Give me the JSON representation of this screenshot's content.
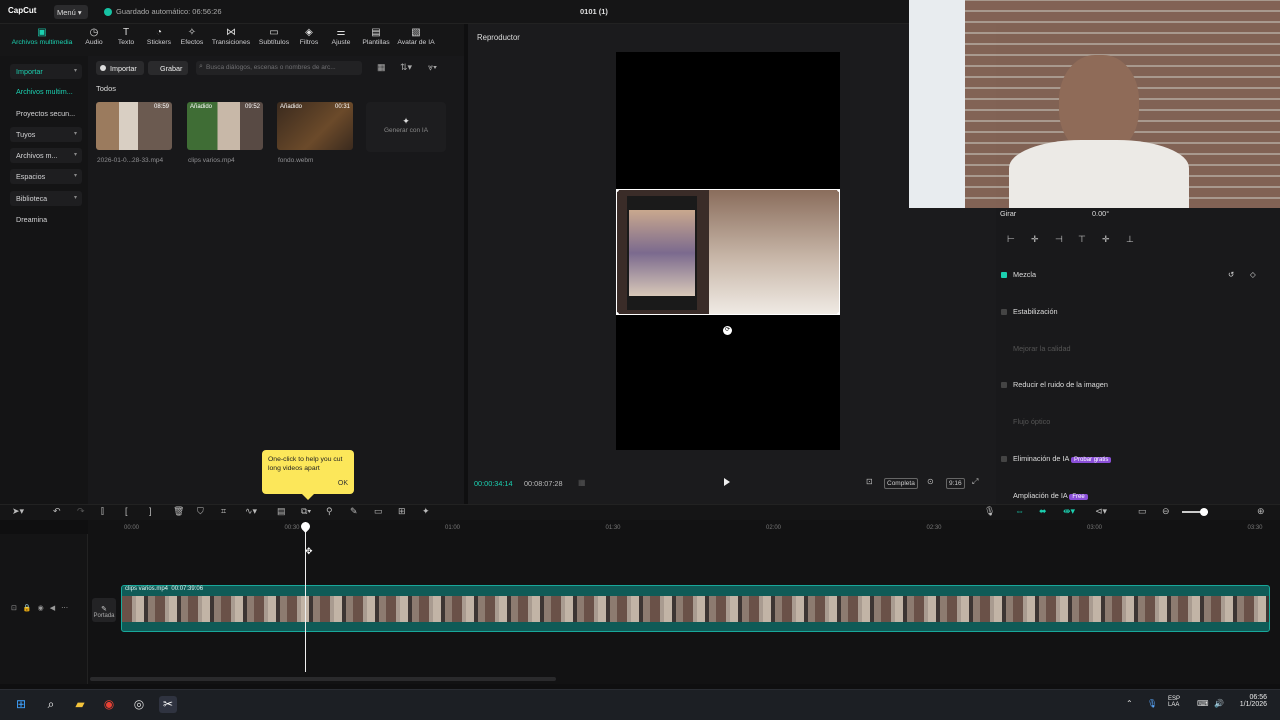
{
  "app": {
    "logo": "CapCut",
    "menu": "Menú",
    "autosave": "Guardado automático: 06:56:26",
    "project_title": "0101 (1)"
  },
  "toolbar": [
    {
      "label": "Archivos multimedia",
      "icon": "media-icon",
      "glyph": "▣",
      "active": true
    },
    {
      "label": "Audio",
      "icon": "audio-icon",
      "glyph": "◷"
    },
    {
      "label": "Texto",
      "icon": "text-icon",
      "glyph": "T"
    },
    {
      "label": "Stickers",
      "icon": "sticker-icon",
      "glyph": "◔"
    },
    {
      "label": "Efectos",
      "icon": "effects-icon",
      "glyph": "✧"
    },
    {
      "label": "Transiciones",
      "icon": "transitions-icon",
      "glyph": "⋈"
    },
    {
      "label": "Subtítulos",
      "icon": "subtitles-icon",
      "glyph": "▭"
    },
    {
      "label": "Filtros",
      "icon": "filters-icon",
      "glyph": "◈"
    },
    {
      "label": "Ajuste",
      "icon": "adjust-icon",
      "glyph": "⚌"
    },
    {
      "label": "Plantillas",
      "icon": "templates-icon",
      "glyph": "▤"
    },
    {
      "label": "Avatar de IA",
      "icon": "ai-avatar-icon",
      "glyph": "▧"
    }
  ],
  "leftnav": [
    {
      "label": "Importar",
      "selected": true,
      "chev": true
    },
    {
      "label": "Archivos multim...",
      "selected": true,
      "plain": true
    },
    {
      "label": "Proyectos secun...",
      "plain": true
    },
    {
      "label": "Tuyos",
      "chev": true
    },
    {
      "label": "Archivos m...",
      "chev": true
    },
    {
      "label": "Espacios",
      "chev": true
    },
    {
      "label": "Biblioteca",
      "chev": true
    },
    {
      "label": "Dreamina",
      "plain": true
    }
  ],
  "media": {
    "import_label": "Importar",
    "record_label": "Grabar",
    "search_placeholder": "Busca diálogos, escenas o nombres de arc...",
    "section": "Todos",
    "items": [
      {
        "name": "2026-01-0...28-33.mp4",
        "badge": "",
        "duration": "08:59"
      },
      {
        "name": "clips varios.mp4",
        "badge": "Añadido",
        "duration": "09:52"
      },
      {
        "name": "fondo.webm",
        "badge": "Añadido",
        "duration": "00:31"
      }
    ],
    "ai_generate": "Generar con IA"
  },
  "tooltip": {
    "text": "One-click to help you cut long videos apart",
    "ok": "OK"
  },
  "player": {
    "title": "Reproductor",
    "current_time": "00:00:34:14",
    "total_time": "00:08:07:28",
    "ratio_label": "Completa",
    "ratio2": "9:16"
  },
  "properties": {
    "rotate_label": "Girar",
    "rotate_value": "0.00°",
    "mezcla": "Mezcla",
    "estabilizacion": "Estabilización",
    "mejorar": "Mejorar la calidad",
    "reducir": "Reducir el ruido de la imagen",
    "flujo": "Flujo óptico",
    "eliminacion": "Eliminación de IA",
    "eliminacion_tag": "Probar gratis",
    "ampliacion": "Ampliación de IA",
    "ampliacion_tag": "Free"
  },
  "timeline": {
    "ticks": [
      "00:00",
      "00:30",
      "01:00",
      "01:30",
      "02:00",
      "02:30",
      "03:00",
      "03:30"
    ],
    "clip_label": "clips varios.mp4",
    "clip_duration": "00:07:39:06",
    "cover_label": "Portada"
  },
  "taskbar": {
    "lang": "ESP",
    "lang2": "LAA",
    "time": "06:56",
    "date": "1/1/2026"
  }
}
